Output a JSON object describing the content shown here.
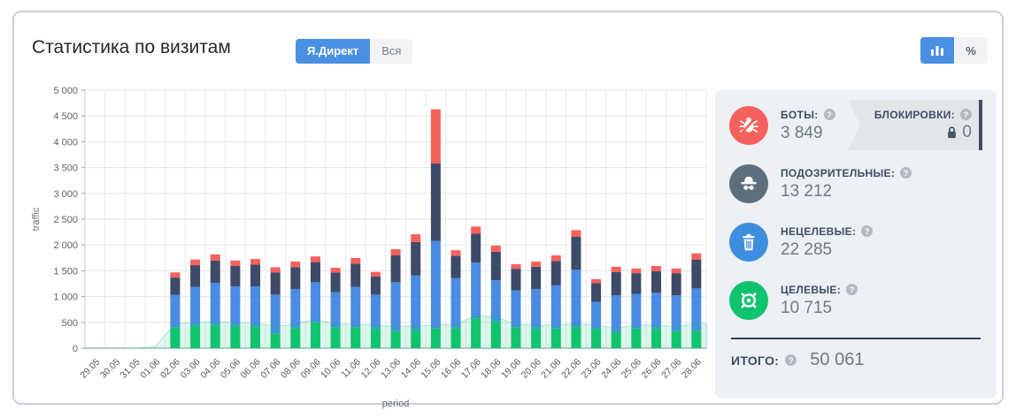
{
  "header": {
    "title": "Статистика по визитам",
    "source_toggle": [
      {
        "label": "Я.Директ",
        "active": true
      },
      {
        "label": "Вся",
        "active": false
      }
    ],
    "view_toggle": {
      "chart_icon": "bar-chart-icon",
      "percent_label": "%"
    }
  },
  "colors": {
    "accent_blue": "#4a90e2",
    "bots_red": "#f6605d",
    "suspicious_dark": "#3d4a68",
    "suspicious_circle": "#5d6f7d",
    "nontargeted_blue": "#4a8be4",
    "nontargeted_circle": "#3e8ee0",
    "targeted_green": "#10c36f",
    "panel_bg": "#edf0f4",
    "banner_bg": "#e3e6e9",
    "banner_bar": "#3f4d66"
  },
  "panel": {
    "stats": [
      {
        "id": "bots",
        "icon": "bug-icon",
        "label": "БОТЫ:",
        "value": "3 849",
        "color": "#f6605d"
      },
      {
        "id": "suspicious",
        "icon": "spy-icon",
        "label": "ПОДОЗРИТЕЛЬНЫЕ:",
        "value": "13 212",
        "color": "#5d6f7d"
      },
      {
        "id": "nontargeted",
        "icon": "trash-icon",
        "label": "НЕЦЕЛЕВЫЕ:",
        "value": "22 285",
        "color": "#3e8ee0"
      },
      {
        "id": "targeted",
        "icon": "target-icon",
        "label": "ЦЕЛЕВЫЕ:",
        "value": "10 715",
        "color": "#10c36f"
      }
    ],
    "blocks": {
      "label": "БЛОКИРОВКИ:",
      "value": "0"
    },
    "total": {
      "label": "ИТОГО:",
      "value": "50 061"
    }
  },
  "chart_data": {
    "type": "bar",
    "subtype": "stacked-bars-with-area-overlay",
    "title": "",
    "xlabel": "period",
    "ylabel": "traffic",
    "ylim": [
      0,
      5000
    ],
    "ytick_interval": 500,
    "ytick_labels": [
      "0",
      "500",
      "1 000",
      "1 500",
      "2 000",
      "2 500",
      "3 000",
      "3 500",
      "4 000",
      "4 500",
      "5 000"
    ],
    "grid": true,
    "legend": "none",
    "categories": [
      "29.05",
      "30.05",
      "31.05",
      "01.06",
      "02.06",
      "03.06",
      "04.06",
      "05.06",
      "06.06",
      "07.06",
      "08.06",
      "09.06",
      "10.06",
      "11.06",
      "12.06",
      "13.06",
      "14.06",
      "15.06",
      "16.06",
      "17.06",
      "18.06",
      "19.06",
      "20.06",
      "21.06",
      "22.06",
      "23.06",
      "24.06",
      "25.06",
      "26.06",
      "27.06",
      "28.06"
    ],
    "series": [
      {
        "name": "ЦЕЛЕВЫЕ",
        "color": "#10c36f",
        "values": [
          0,
          0,
          0,
          0,
          400,
          430,
          450,
          430,
          420,
          285,
          390,
          500,
          400,
          400,
          380,
          330,
          350,
          380,
          390,
          580,
          520,
          400,
          380,
          380,
          410,
          370,
          310,
          380,
          380,
          330,
          340
        ]
      },
      {
        "name": "НЕЦЕЛЕВЫЕ",
        "color": "#4a8be4",
        "values": [
          0,
          0,
          0,
          0,
          636,
          758,
          818,
          768,
          778,
          753,
          758,
          778,
          688,
          788,
          658,
          948,
          1058,
          1699,
          968,
          1078,
          798,
          718,
          768,
          838,
          1108,
          528,
          718,
          673,
          693,
          693,
          818
        ]
      },
      {
        "name": "ПОДОЗРИТЕЛЬНЫЕ",
        "color": "#3d4a68",
        "values": [
          0,
          0,
          0,
          0,
          332,
          420,
          430,
          400,
          420,
          430,
          420,
          390,
          380,
          450,
          350,
          520,
          650,
          1500,
          430,
          560,
          550,
          420,
          430,
          470,
          640,
          360,
          450,
          400,
          420,
          430,
          560
        ]
      },
      {
        "name": "БОТЫ",
        "color": "#f6605d",
        "values": [
          0,
          0,
          0,
          0,
          100,
          110,
          120,
          100,
          110,
          100,
          110,
          110,
          90,
          110,
          90,
          120,
          150,
          1049,
          110,
          140,
          120,
          90,
          100,
          110,
          130,
          80,
          100,
          90,
          100,
          90,
          120
        ]
      }
    ],
    "area_series": {
      "name": "ЦЕЛЕВЫЕ (area)",
      "fill": "rgba(16,195,111,0.14)",
      "stroke": "rgba(16,195,111,0.30)",
      "values": [
        0,
        0,
        0,
        30,
        480,
        500,
        510,
        500,
        490,
        420,
        470,
        560,
        470,
        465,
        450,
        420,
        430,
        450,
        460,
        640,
        600,
        470,
        450,
        450,
        480,
        440,
        390,
        450,
        450,
        420,
        480
      ]
    }
  }
}
